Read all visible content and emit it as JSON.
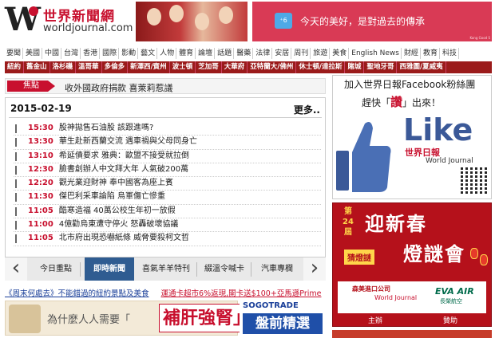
{
  "header": {
    "logo_cn": "世界新聞網",
    "logo_en": "worldjournal.com",
    "banner_right_badge": "⁺6",
    "banner_right_text": "今天的美好，是對過去的傳承",
    "banner_right_small": "Kong Good S"
  },
  "nav_primary": [
    "要聞",
    "美國",
    "中國",
    "台灣",
    "香港",
    "國際",
    "影動",
    "藝文",
    "人物",
    "體育",
    "論壇",
    "話題",
    "醫藥",
    "法律",
    "安居",
    "周刊",
    "旅遊",
    "美食",
    "English News",
    "財經",
    "教育",
    "科技"
  ],
  "nav_regions": [
    "紐約",
    "舊金山",
    "洛杉磯",
    "溫哥華",
    "多倫多",
    "新澤西/賓州",
    "波士頓",
    "芝加哥",
    "大華府",
    "亞特蘭大/佛州",
    "休士頓/達拉斯",
    "賭城",
    "聖地牙哥",
    "西雅圖/夏威夷"
  ],
  "focus": {
    "tag": "焦點",
    "text": "收外國政府捐款 喜萊莉惹議"
  },
  "news": {
    "date": "2015-02-19",
    "more": "更多..",
    "items": [
      {
        "time": "15:30",
        "title": "股神拋售石油股 該跟進嗎?"
      },
      {
        "time": "13:30",
        "title": "華生赴新西蘭交流 遇車禍與父母同身亡"
      },
      {
        "time": "13:10",
        "title": "希延債要求 雅典：歐盟不接受就拉倒"
      },
      {
        "time": "12:30",
        "title": "臉書創辦人中文拜大年 人氣破200萬"
      },
      {
        "time": "12:20",
        "title": "觀光業迎財神 奉中國客為座上賓"
      },
      {
        "time": "11:30",
        "title": "傑巴利采車論陷 烏軍傷亡慘重"
      },
      {
        "time": "11:05",
        "title": "酷寒造福 40萬公校生年初一放假"
      },
      {
        "time": "11:00",
        "title": "4億勸烏東遭守停火 怒轟破壞協議"
      },
      {
        "time": "11:05",
        "title": "北市府出現恐嚇紙條 威脅要殺柯文哲"
      }
    ]
  },
  "tabs": [
    "今日重點",
    "即時新聞",
    "喜氣羊羊特刊",
    "綴溫令喊卡",
    "汽車專欄"
  ],
  "promo_links": {
    "left": "《周末何處去》不能錯過的紐約景點及美食",
    "right": "運通卡超市6%返現,開卡送$100+亞馬遜Prime"
  },
  "ad_liver": {
    "question": "為什麼人人需要「",
    "highlight": "補肝強腎」?"
  },
  "ad_sogo": {
    "brand": "SOGOTRADE",
    "tagline": "盤前精選"
  },
  "facebook": {
    "line1": "加入世界日報Facebook粉絲團",
    "line2a": "趕快「",
    "praise": "讚",
    "line2b": "」出來！",
    "like": "Like",
    "brand_cn": "世界日報",
    "brand_en": "World Journal"
  },
  "cny": {
    "num": "第24屆",
    "title1": "迎新春",
    "riddle": "猜燈謎",
    "title2": "燈謎會",
    "sponsor1": "森美進口公司",
    "sponsor1b": "World Journal",
    "sponsor2": "EVA AIR",
    "sponsor2b": "長榮航空",
    "host": "主辦",
    "sponsor": "贊助"
  },
  "colors": {
    "brand_red": "#c8102e",
    "nav_dark_red": "#9b1b1b",
    "tab_active": "#2f5c91",
    "facebook_blue": "#3b5998"
  }
}
